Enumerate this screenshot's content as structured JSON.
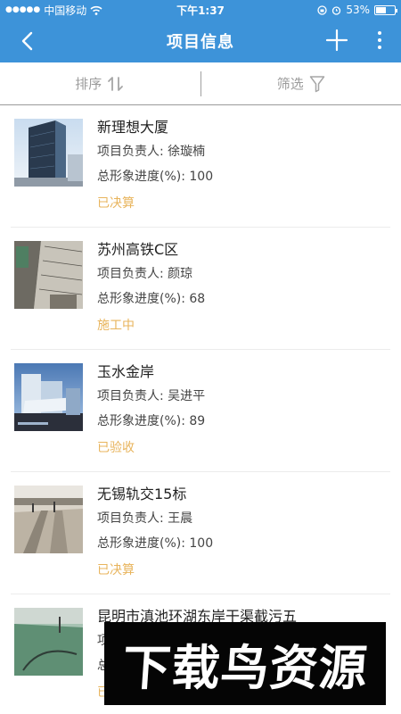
{
  "status_bar": {
    "carrier": "中国移动",
    "time": "下午1:37",
    "battery": "53%",
    "battery_level": 0.53
  },
  "nav": {
    "title": "项目信息",
    "back_icon": "chevron-left-icon",
    "add_icon": "plus-icon",
    "more_icon": "more-vertical-icon"
  },
  "filters": {
    "sort_label": "排序",
    "filter_label": "筛选"
  },
  "projects": [
    {
      "name": "新理想大厦",
      "manager": "项目负责人: 徐璇楠",
      "progress": "总形象进度(%): 100",
      "status": "已决算"
    },
    {
      "name": "苏州高铁C区",
      "manager": "项目负责人: 颜琼",
      "progress": "总形象进度(%): 68",
      "status": "施工中"
    },
    {
      "name": "玉水金岸",
      "manager": "项目负责人: 吴进平",
      "progress": "总形象进度(%): 89",
      "status": "已验收"
    },
    {
      "name": "无锡轨交15标",
      "manager": "项目负责人: 王晨",
      "progress": "总形象进度(%): 100",
      "status": "已决算"
    },
    {
      "name": "昆明市滇池环湖东岸干渠截污五",
      "manager": "项",
      "progress": "总",
      "status": "已"
    }
  ],
  "watermark": "下载鸟资源",
  "colors": {
    "header": "#3d93d9",
    "status_text": "#e8b45c"
  }
}
